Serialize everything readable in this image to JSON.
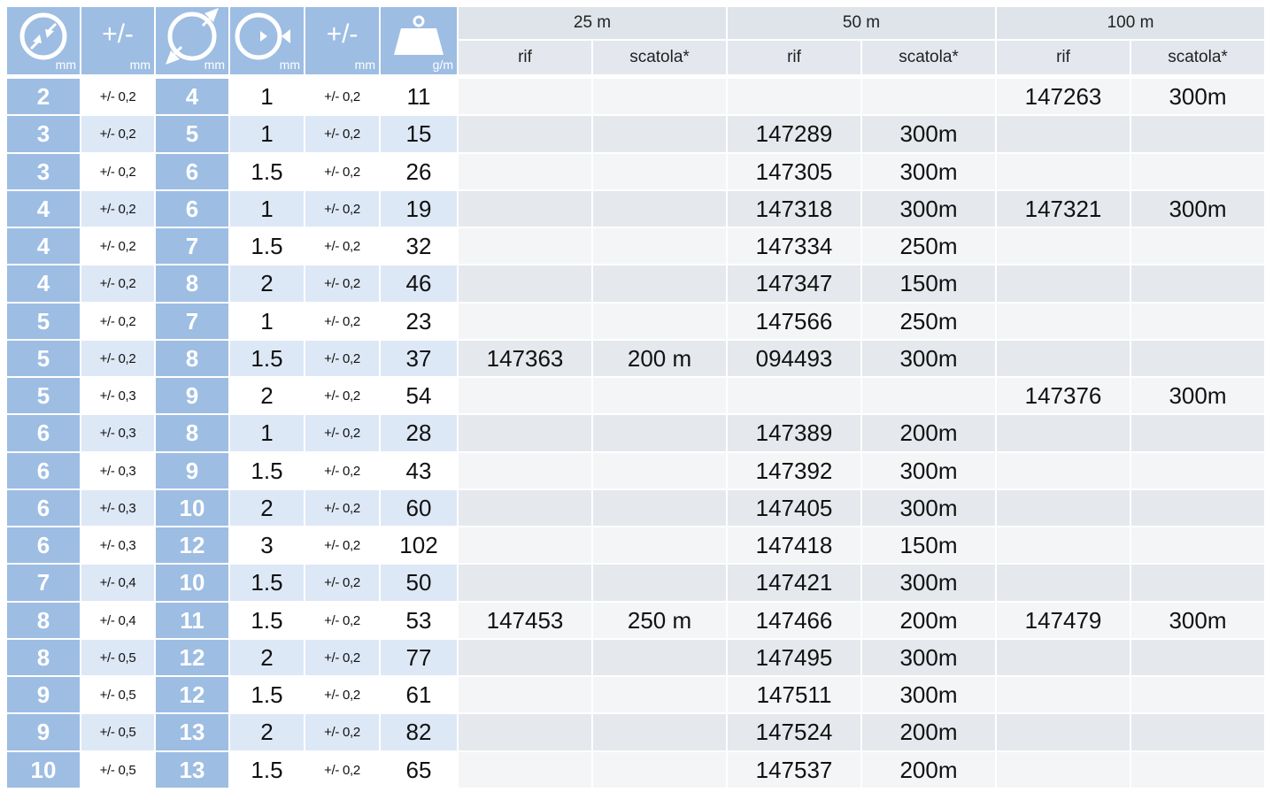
{
  "header": {
    "left_units": [
      "mm",
      "mm",
      "mm",
      "mm",
      "mm",
      "g/m"
    ],
    "pm_label": "+/-",
    "groups": [
      "25 m",
      "50 m",
      "100 m"
    ],
    "sub_rif": "rif",
    "sub_scatola": "scatola*",
    "icons": [
      "inner-diameter-icon",
      "tolerance-label",
      "outer-diameter-icon",
      "wall-thickness-icon",
      "tolerance-label",
      "weight-icon"
    ]
  },
  "rows": [
    [
      "2",
      "+/- 0,2",
      "4",
      "1",
      "+/- 0,2",
      "11",
      "",
      "",
      "",
      "",
      "147263",
      "300m"
    ],
    [
      "3",
      "+/- 0,2",
      "5",
      "1",
      "+/- 0,2",
      "15",
      "",
      "",
      "147289",
      "300m",
      "",
      ""
    ],
    [
      "3",
      "+/- 0,2",
      "6",
      "1.5",
      "+/- 0,2",
      "26",
      "",
      "",
      "147305",
      "300m",
      "",
      ""
    ],
    [
      "4",
      "+/- 0,2",
      "6",
      "1",
      "+/- 0,2",
      "19",
      "",
      "",
      "147318",
      "300m",
      "147321",
      "300m"
    ],
    [
      "4",
      "+/- 0,2",
      "7",
      "1.5",
      "+/- 0,2",
      "32",
      "",
      "",
      "147334",
      "250m",
      "",
      ""
    ],
    [
      "4",
      "+/- 0,2",
      "8",
      "2",
      "+/- 0,2",
      "46",
      "",
      "",
      "147347",
      "150m",
      "",
      ""
    ],
    [
      "5",
      "+/- 0,2",
      "7",
      "1",
      "+/- 0,2",
      "23",
      "",
      "",
      "147566",
      "250m",
      "",
      ""
    ],
    [
      "5",
      "+/- 0,2",
      "8",
      "1.5",
      "+/- 0,2",
      "37",
      "147363",
      "200 m",
      "094493",
      "300m",
      "",
      ""
    ],
    [
      "5",
      "+/- 0,3",
      "9",
      "2",
      "+/- 0,2",
      "54",
      "",
      "",
      "",
      "",
      "147376",
      "300m"
    ],
    [
      "6",
      "+/- 0,3",
      "8",
      "1",
      "+/- 0,2",
      "28",
      "",
      "",
      "147389",
      "200m",
      "",
      ""
    ],
    [
      "6",
      "+/- 0,3",
      "9",
      "1.5",
      "+/- 0,2",
      "43",
      "",
      "",
      "147392",
      "300m",
      "",
      ""
    ],
    [
      "6",
      "+/- 0,3",
      "10",
      "2",
      "+/- 0,2",
      "60",
      "",
      "",
      "147405",
      "300m",
      "",
      ""
    ],
    [
      "6",
      "+/- 0,3",
      "12",
      "3",
      "+/- 0,2",
      "102",
      "",
      "",
      "147418",
      "150m",
      "",
      ""
    ],
    [
      "7",
      "+/- 0,4",
      "10",
      "1.5",
      "+/- 0,2",
      "50",
      "",
      "",
      "147421",
      "300m",
      "",
      ""
    ],
    [
      "8",
      "+/- 0,4",
      "11",
      "1.5",
      "+/- 0,2",
      "53",
      "147453",
      "250 m",
      "147466",
      "200m",
      "147479",
      "300m"
    ],
    [
      "8",
      "+/- 0,5",
      "12",
      "2",
      "+/- 0,2",
      "77",
      "",
      "",
      "147495",
      "300m",
      "",
      ""
    ],
    [
      "9",
      "+/- 0,5",
      "12",
      "1.5",
      "+/- 0,2",
      "61",
      "",
      "",
      "147511",
      "300m",
      "",
      ""
    ],
    [
      "9",
      "+/- 0,5",
      "13",
      "2",
      "+/- 0,2",
      "82",
      "",
      "",
      "147524",
      "200m",
      "",
      ""
    ],
    [
      "10",
      "+/- 0,5",
      "13",
      "1.5",
      "+/- 0,2",
      "65",
      "",
      "",
      "147537",
      "200m",
      "",
      ""
    ]
  ],
  "colors": {
    "dark_col": "#9dbde3",
    "light_even": "#dde8f6",
    "right_odd": "#f3f5f7",
    "right_even": "#e5e8ec",
    "header_gray": "#dfe4ea"
  }
}
